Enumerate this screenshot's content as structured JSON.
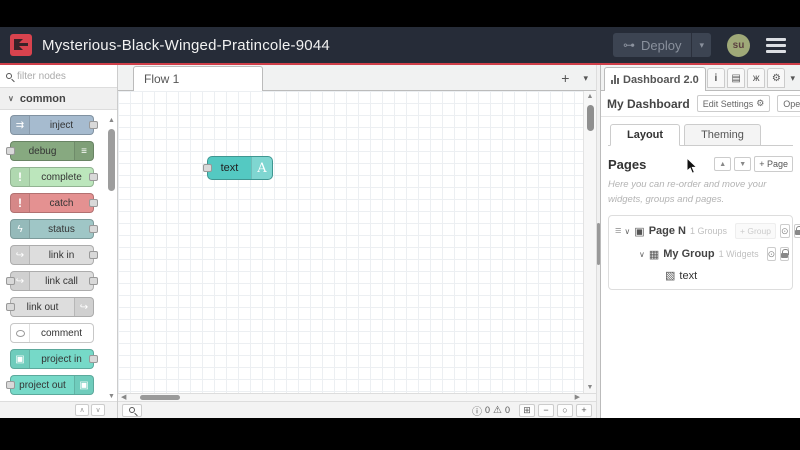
{
  "header": {
    "title": "Mysterious-Black-Winged-Pratincole-9044",
    "deploy_label": "Deploy",
    "user_initials": "su"
  },
  "palette": {
    "search_placeholder": "filter nodes",
    "category_label": "common",
    "nodes": [
      {
        "label": "inject",
        "color": "#a6bbcf",
        "icon": "inject-arrows-icon",
        "icon_side": "left",
        "ports": "right"
      },
      {
        "label": "debug",
        "color": "#87a980",
        "icon": "debug-list-icon",
        "icon_side": "right",
        "ports": "left"
      },
      {
        "label": "complete",
        "color": "#bce6bc",
        "icon": "exclamation-icon",
        "icon_side": "left",
        "ports": "right"
      },
      {
        "label": "catch",
        "color": "#e49191",
        "icon": "exclamation-icon",
        "icon_side": "left",
        "ports": "right"
      },
      {
        "label": "status",
        "color": "#9fc6c6",
        "icon": "status-pulse-icon",
        "icon_side": "left",
        "ports": "right"
      },
      {
        "label": "link in",
        "color": "#dddddd",
        "icon": "link-icon",
        "icon_side": "left",
        "ports": "right"
      },
      {
        "label": "link call",
        "color": "#dddddd",
        "icon": "link-icon",
        "icon_side": "left",
        "ports": "both"
      },
      {
        "label": "link out",
        "color": "#dddddd",
        "icon": "link-icon",
        "icon_side": "right",
        "ports": "left"
      },
      {
        "label": "comment",
        "color": "#ffffff",
        "icon": "comment-bubble-icon",
        "icon_side": "left",
        "ports": "none"
      },
      {
        "label": "project in",
        "color": "#76d9c8",
        "icon": "project-logo-icon",
        "icon_side": "left",
        "ports": "right"
      },
      {
        "label": "project out",
        "color": "#76d9c8",
        "icon": "project-logo-icon",
        "icon_side": "right",
        "ports": "left"
      }
    ]
  },
  "canvas": {
    "tab_label": "Flow 1",
    "node": {
      "label": "text",
      "badge": "A",
      "color": "#54c9c2"
    },
    "footer": {
      "info_count": "0",
      "warning_count": "0"
    }
  },
  "sidebar": {
    "active_tab_label": "Dashboard 2.0",
    "dashboard_title": "My Dashboard",
    "edit_settings_label": "Edit Settings",
    "open_dashboard_label": "Open Dashboard",
    "layout_tab_label": "Layout",
    "theming_tab_label": "Theming",
    "pages_title": "Pages",
    "add_page_label": "+ Page",
    "hint": "Here you can re-order and move your widgets, groups and pages.",
    "tree": {
      "page_name": "Page N",
      "page_count": "1 Groups",
      "add_group_label": "+ Group",
      "group_name": "My Group",
      "group_count": "1 Widgets",
      "widget_name": "text"
    }
  },
  "colors": {
    "accent_red": "#cf3f49",
    "header_bg": "#262c38",
    "flow_node_teal": "#54c9c2"
  }
}
